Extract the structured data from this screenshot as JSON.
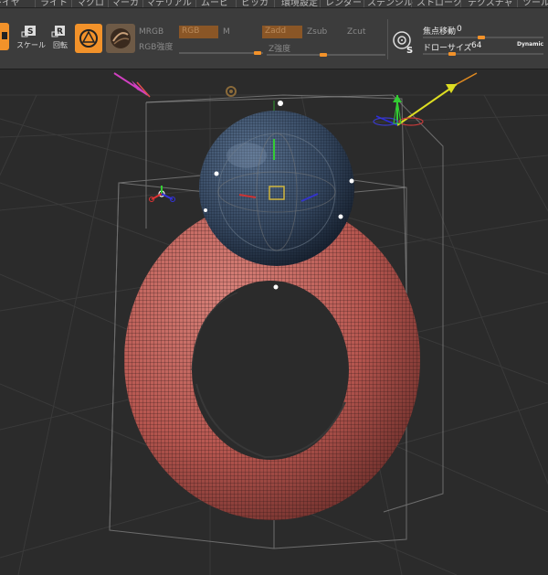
{
  "menu": {
    "items": [
      "レイヤ",
      "ライト",
      "マクロ",
      "マーカ",
      "マテリアル",
      "ムービ",
      "ピッカ",
      "環境設定",
      "レンダー",
      "ステンシル",
      "ストローク",
      "テクスチャ",
      "ツール"
    ]
  },
  "toolbar": {
    "scale_label": "スケール",
    "rotate_label": "回転",
    "channels": {
      "mrgb": "MRGB",
      "rgb": "RGB",
      "m": "M",
      "zadd": "Zadd",
      "zsub": "Zsub",
      "zcut": "Zcut"
    },
    "rgb_intensity_label": "RGB強度",
    "z_intensity_label": "Z強度",
    "focal_shift_label": "焦点移動",
    "focal_shift_value": "0",
    "draw_size_label": "ドローサイズ",
    "draw_size_value": "64",
    "dynamic_label": "Dynamic"
  },
  "colors": {
    "accent": "#f2922a",
    "active_channel": "#8a5626",
    "torus": "#c0625e",
    "sphere": "#34465e",
    "background": "#2b2b2b"
  }
}
